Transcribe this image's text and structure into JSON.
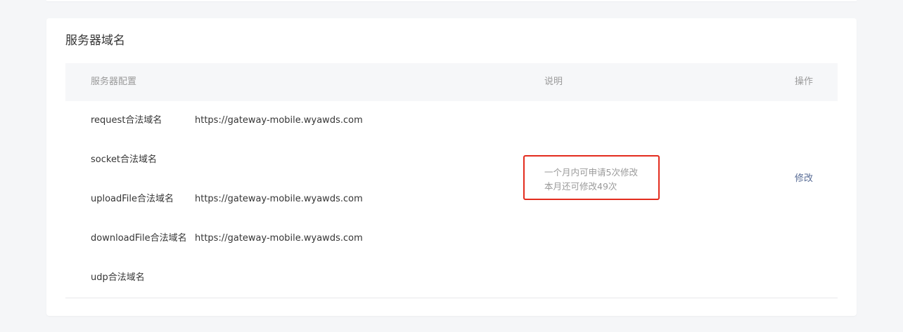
{
  "card": {
    "title": "服务器域名"
  },
  "table": {
    "headers": {
      "config": "服务器配置",
      "description": "说明",
      "action": "操作"
    },
    "rows": [
      {
        "name": "request合法域名",
        "value": "https://gateway-mobile.wyawds.com"
      },
      {
        "name": "socket合法域名",
        "value": ""
      },
      {
        "name": "uploadFile合法域名",
        "value": "https://gateway-mobile.wyawds.com"
      },
      {
        "name": "downloadFile合法域名",
        "value": "https://gateway-mobile.wyawds.com"
      },
      {
        "name": "udp合法域名",
        "value": ""
      }
    ],
    "description": {
      "line1": "一个月内可申请5次修改",
      "line2": "本月还可修改49次"
    },
    "action_label": "修改"
  },
  "colors": {
    "link": "#576b95",
    "highlight_border": "#e32c1e",
    "header_bg": "#f6f7f9",
    "page_bg": "#f5f6f8"
  }
}
